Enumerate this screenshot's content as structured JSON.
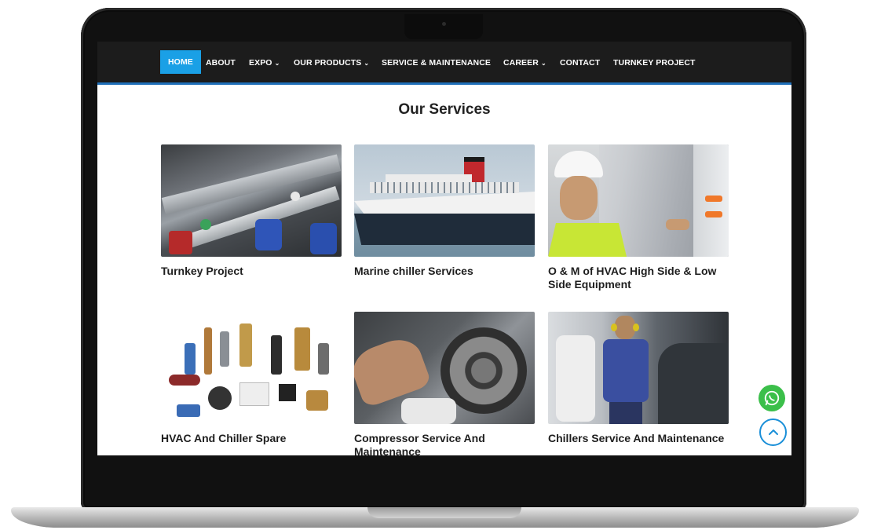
{
  "nav": {
    "items": [
      {
        "label": "HOME",
        "active": true,
        "dropdown": false
      },
      {
        "label": "ABOUT",
        "active": false,
        "dropdown": false
      },
      {
        "label": "EXPO",
        "active": false,
        "dropdown": true
      },
      {
        "label": "OUR PRODUCTS",
        "active": false,
        "dropdown": true
      },
      {
        "label": "SERVICE & MAINTENANCE",
        "active": false,
        "dropdown": false
      },
      {
        "label": "CAREER",
        "active": false,
        "dropdown": true
      },
      {
        "label": "CONTACT",
        "active": false,
        "dropdown": false
      },
      {
        "label": "TURNKEY PROJECT",
        "active": false,
        "dropdown": false
      }
    ],
    "caret_glyph": "⌄"
  },
  "services": {
    "title": "Our Services",
    "cards": [
      {
        "caption": "Turnkey Project",
        "image": "piping-pumps-photo"
      },
      {
        "caption": "Marine chiller Services",
        "image": "cruise-ship-photo"
      },
      {
        "caption": "O & M of HVAC High Side & Low Side Equipment",
        "image": "engineer-hardhat-photo"
      },
      {
        "caption": "HVAC And Chiller Spare",
        "image": "valves-parts-photo"
      },
      {
        "caption": "Compressor Service And Maintenance",
        "image": "compressor-repair-photo"
      },
      {
        "caption": "Chillers Service And Maintenance",
        "image": "chiller-plant-worker-photo"
      }
    ]
  },
  "floating": {
    "whatsapp_icon": "whatsapp-icon",
    "scroll_top_icon": "chevron-up-icon"
  },
  "colors": {
    "nav_bg": "#1c1c1c",
    "nav_active": "#1aa0e6",
    "nav_underline": "#1f6fb8",
    "whatsapp": "#3bbf4a",
    "scroll_top": "#1a8fd8"
  }
}
